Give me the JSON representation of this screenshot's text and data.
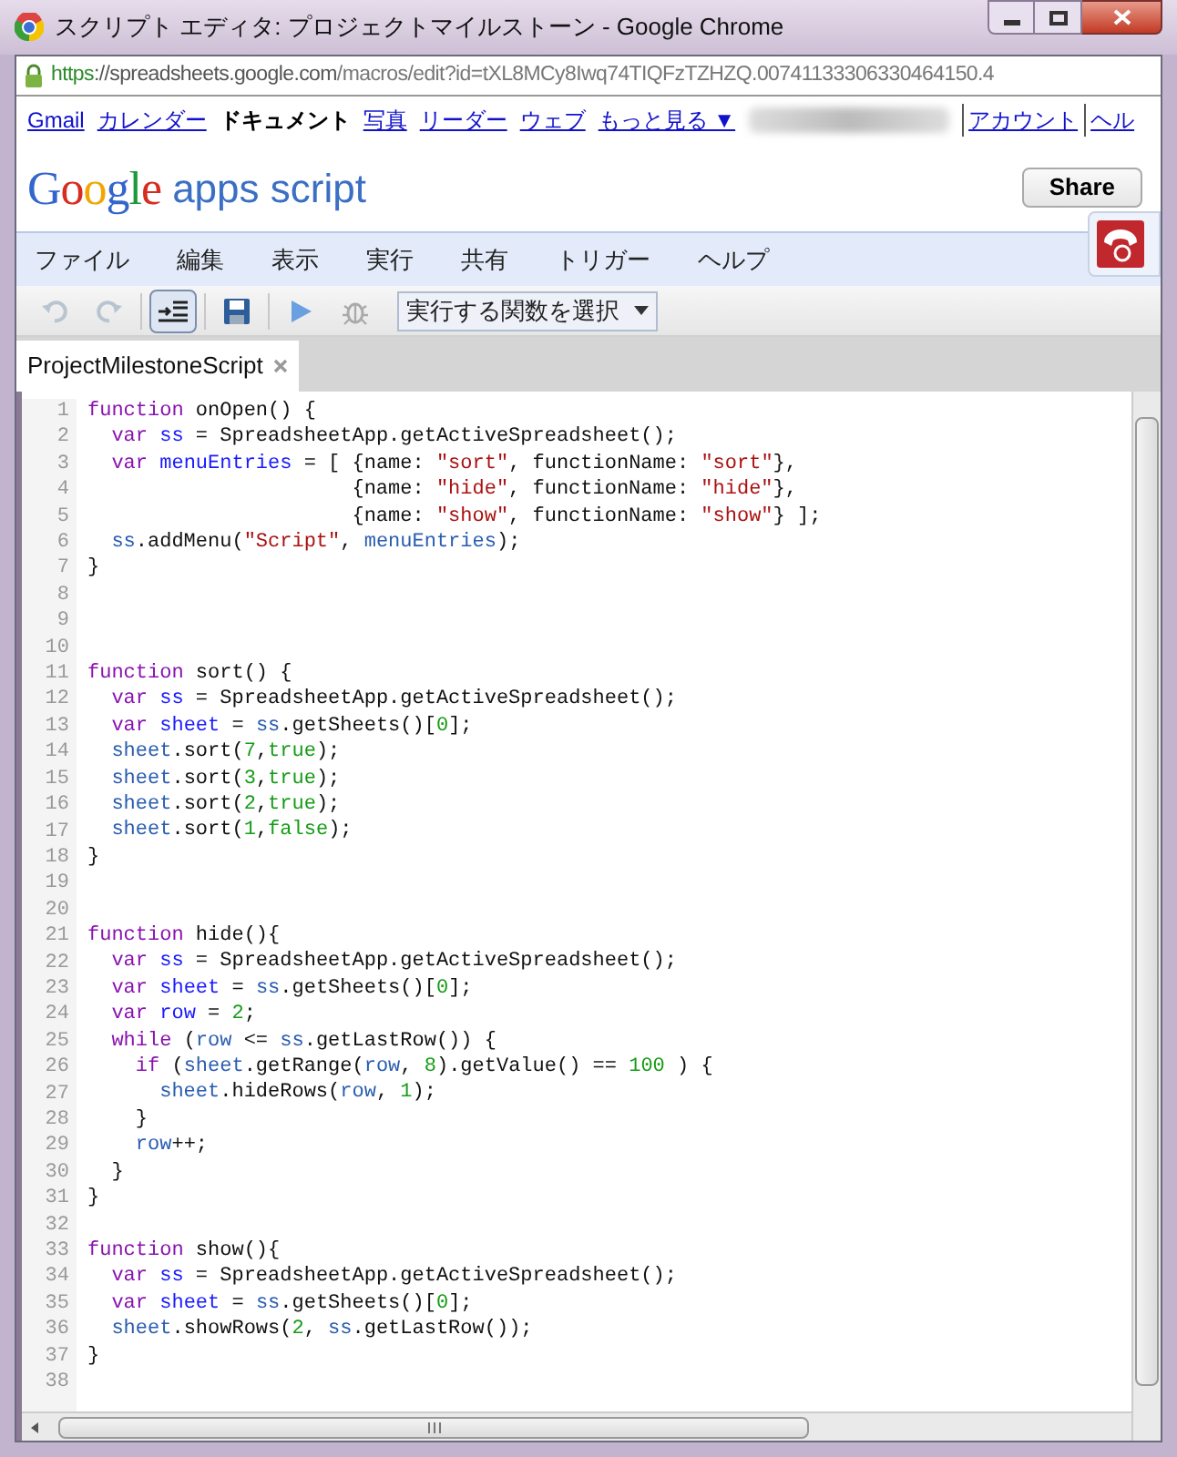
{
  "window": {
    "title": "スクリプト エディタ: プロジェクトマイルストーン - Google Chrome"
  },
  "address_bar": {
    "scheme": "https",
    "rest": "://spreadsheets.google.com",
    "path": "/macros/edit?id=tXL8MCy8Iwq74TIQFzTZHZQ.00741133306330464150.4"
  },
  "google_bar": {
    "items": [
      {
        "label": "Gmail",
        "selected": false
      },
      {
        "label": "カレンダー",
        "selected": false
      },
      {
        "label": "ドキュメント",
        "selected": true
      },
      {
        "label": "写真",
        "selected": false
      },
      {
        "label": "リーダー",
        "selected": false
      },
      {
        "label": "ウェブ",
        "selected": false
      },
      {
        "label": "もっと見る ▼",
        "selected": false
      }
    ],
    "account_links": [
      "アカウント",
      "ヘル"
    ]
  },
  "header": {
    "logo_word": "Google",
    "product": "apps script",
    "share_button": "Share"
  },
  "menu": [
    "ファイル",
    "編集",
    "表示",
    "実行",
    "共有",
    "トリガー",
    "ヘルプ"
  ],
  "toolbar": {
    "buttons": [
      {
        "kind": "undo",
        "disabled": true
      },
      {
        "kind": "redo",
        "disabled": true
      },
      {
        "kind": "indent",
        "pressed": true
      },
      {
        "kind": "save",
        "disabled": false
      },
      {
        "kind": "run",
        "disabled": false
      },
      {
        "kind": "debug",
        "disabled": true
      }
    ],
    "function_select": "実行する関数を選択"
  },
  "tabs": [
    {
      "label": "ProjectMilestoneScript",
      "selected": true
    }
  ],
  "code_lines": [
    {
      "number": "1",
      "tokens": [
        {
          "kind": "keyword",
          "text": "function"
        },
        {
          "kind": "plain",
          "text": " onOpen() {"
        }
      ]
    },
    {
      "number": "2",
      "tokens": [
        {
          "kind": "keyword",
          "text": "  var"
        },
        {
          "kind": "def",
          "text": " ss"
        },
        {
          "kind": "plain",
          "text": " = SpreadsheetApp.getActiveSpreadsheet();"
        }
      ]
    },
    {
      "number": "3",
      "tokens": [
        {
          "kind": "keyword",
          "text": "  var"
        },
        {
          "kind": "def",
          "text": " menuEntries"
        },
        {
          "kind": "plain",
          "text": " = [ {name: "
        },
        {
          "kind": "string",
          "text": "\"sort\""
        },
        {
          "kind": "plain",
          "text": ", functionName: "
        },
        {
          "kind": "string",
          "text": "\"sort\""
        },
        {
          "kind": "plain",
          "text": "},"
        }
      ]
    },
    {
      "number": "4",
      "tokens": [
        {
          "kind": "plain",
          "text": "                      {name: "
        },
        {
          "kind": "string",
          "text": "\"hide\""
        },
        {
          "kind": "plain",
          "text": ", functionName: "
        },
        {
          "kind": "string",
          "text": "\"hide\""
        },
        {
          "kind": "plain",
          "text": "},"
        }
      ]
    },
    {
      "number": "5",
      "tokens": [
        {
          "kind": "plain",
          "text": "                      {name: "
        },
        {
          "kind": "string",
          "text": "\"show\""
        },
        {
          "kind": "plain",
          "text": ", functionName: "
        },
        {
          "kind": "string",
          "text": "\"show\""
        },
        {
          "kind": "plain",
          "text": "} ];"
        }
      ]
    },
    {
      "number": "6",
      "tokens": [
        {
          "kind": "variable",
          "text": "  ss"
        },
        {
          "kind": "plain",
          "text": ".addMenu("
        },
        {
          "kind": "string",
          "text": "\"Script\""
        },
        {
          "kind": "plain",
          "text": ", "
        },
        {
          "kind": "variable",
          "text": "menuEntries"
        },
        {
          "kind": "plain",
          "text": ");"
        }
      ]
    },
    {
      "number": "7",
      "tokens": [
        {
          "kind": "plain",
          "text": "}"
        }
      ]
    },
    {
      "number": "8"
    },
    {
      "number": "9"
    },
    {
      "number": "10"
    },
    {
      "number": "11",
      "tokens": [
        {
          "kind": "keyword",
          "text": "function"
        },
        {
          "kind": "plain",
          "text": " sort() {"
        }
      ]
    },
    {
      "number": "12",
      "tokens": [
        {
          "kind": "keyword",
          "text": "  var"
        },
        {
          "kind": "def",
          "text": " ss"
        },
        {
          "kind": "plain",
          "text": " = SpreadsheetApp.getActiveSpreadsheet();"
        }
      ]
    },
    {
      "number": "13",
      "tokens": [
        {
          "kind": "keyword",
          "text": "  var"
        },
        {
          "kind": "def",
          "text": " sheet"
        },
        {
          "kind": "plain",
          "text": " = "
        },
        {
          "kind": "variable",
          "text": "ss"
        },
        {
          "kind": "plain",
          "text": ".getSheets()["
        },
        {
          "kind": "number",
          "text": "0"
        },
        {
          "kind": "plain",
          "text": "];"
        }
      ]
    },
    {
      "number": "14",
      "tokens": [
        {
          "kind": "variable",
          "text": "  sheet"
        },
        {
          "kind": "plain",
          "text": ".sort("
        },
        {
          "kind": "number",
          "text": "7"
        },
        {
          "kind": "plain",
          "text": ","
        },
        {
          "kind": "number",
          "text": "true"
        },
        {
          "kind": "plain",
          "text": ");"
        }
      ]
    },
    {
      "number": "15",
      "tokens": [
        {
          "kind": "variable",
          "text": "  sheet"
        },
        {
          "kind": "plain",
          "text": ".sort("
        },
        {
          "kind": "number",
          "text": "3"
        },
        {
          "kind": "plain",
          "text": ","
        },
        {
          "kind": "number",
          "text": "true"
        },
        {
          "kind": "plain",
          "text": ");"
        }
      ]
    },
    {
      "number": "16",
      "tokens": [
        {
          "kind": "variable",
          "text": "  sheet"
        },
        {
          "kind": "plain",
          "text": ".sort("
        },
        {
          "kind": "number",
          "text": "2"
        },
        {
          "kind": "plain",
          "text": ","
        },
        {
          "kind": "number",
          "text": "true"
        },
        {
          "kind": "plain",
          "text": ");"
        }
      ]
    },
    {
      "number": "17",
      "tokens": [
        {
          "kind": "variable",
          "text": "  sheet"
        },
        {
          "kind": "plain",
          "text": ".sort("
        },
        {
          "kind": "number",
          "text": "1"
        },
        {
          "kind": "plain",
          "text": ","
        },
        {
          "kind": "number",
          "text": "false"
        },
        {
          "kind": "plain",
          "text": ");"
        }
      ]
    },
    {
      "number": "18",
      "tokens": [
        {
          "kind": "plain",
          "text": "}"
        }
      ]
    },
    {
      "number": "19"
    },
    {
      "number": "20"
    },
    {
      "number": "21",
      "tokens": [
        {
          "kind": "keyword",
          "text": "function"
        },
        {
          "kind": "plain",
          "text": " hide(){"
        }
      ]
    },
    {
      "number": "22",
      "tokens": [
        {
          "kind": "keyword",
          "text": "  var"
        },
        {
          "kind": "def",
          "text": " ss"
        },
        {
          "kind": "plain",
          "text": " = SpreadsheetApp.getActiveSpreadsheet();"
        }
      ]
    },
    {
      "number": "23",
      "tokens": [
        {
          "kind": "keyword",
          "text": "  var"
        },
        {
          "kind": "def",
          "text": " sheet"
        },
        {
          "kind": "plain",
          "text": " = "
        },
        {
          "kind": "variable",
          "text": "ss"
        },
        {
          "kind": "plain",
          "text": ".getSheets()["
        },
        {
          "kind": "number",
          "text": "0"
        },
        {
          "kind": "plain",
          "text": "];"
        }
      ]
    },
    {
      "number": "24",
      "tokens": [
        {
          "kind": "keyword",
          "text": "  var"
        },
        {
          "kind": "def",
          "text": " row"
        },
        {
          "kind": "plain",
          "text": " = "
        },
        {
          "kind": "number",
          "text": "2"
        },
        {
          "kind": "plain",
          "text": ";"
        }
      ]
    },
    {
      "number": "25",
      "tokens": [
        {
          "kind": "keyword",
          "text": "  while"
        },
        {
          "kind": "plain",
          "text": " ("
        },
        {
          "kind": "variable",
          "text": "row"
        },
        {
          "kind": "plain",
          "text": " <= "
        },
        {
          "kind": "variable",
          "text": "ss"
        },
        {
          "kind": "plain",
          "text": ".getLastRow()) {"
        }
      ]
    },
    {
      "number": "26",
      "tokens": [
        {
          "kind": "keyword",
          "text": "    if"
        },
        {
          "kind": "plain",
          "text": " ("
        },
        {
          "kind": "variable",
          "text": "sheet"
        },
        {
          "kind": "plain",
          "text": ".getRange("
        },
        {
          "kind": "variable",
          "text": "row"
        },
        {
          "kind": "plain",
          "text": ", "
        },
        {
          "kind": "number",
          "text": "8"
        },
        {
          "kind": "plain",
          "text": ").getValue() == "
        },
        {
          "kind": "number",
          "text": "100"
        },
        {
          "kind": "plain",
          "text": " ) {"
        }
      ]
    },
    {
      "number": "27",
      "tokens": [
        {
          "kind": "variable",
          "text": "      sheet"
        },
        {
          "kind": "plain",
          "text": ".hideRows("
        },
        {
          "kind": "variable",
          "text": "row"
        },
        {
          "kind": "plain",
          "text": ", "
        },
        {
          "kind": "number",
          "text": "1"
        },
        {
          "kind": "plain",
          "text": ");"
        }
      ]
    },
    {
      "number": "28",
      "tokens": [
        {
          "kind": "plain",
          "text": "    }"
        }
      ]
    },
    {
      "number": "29",
      "tokens": [
        {
          "kind": "variable",
          "text": "    row"
        },
        {
          "kind": "plain",
          "text": "++;"
        }
      ]
    },
    {
      "number": "30",
      "tokens": [
        {
          "kind": "plain",
          "text": "  }"
        }
      ]
    },
    {
      "number": "31",
      "tokens": [
        {
          "kind": "plain",
          "text": "}"
        }
      ]
    },
    {
      "number": "32"
    },
    {
      "number": "33",
      "tokens": [
        {
          "kind": "keyword",
          "text": "function"
        },
        {
          "kind": "plain",
          "text": " show(){"
        }
      ]
    },
    {
      "number": "34",
      "tokens": [
        {
          "kind": "keyword",
          "text": "  var"
        },
        {
          "kind": "def",
          "text": " ss"
        },
        {
          "kind": "plain",
          "text": " = SpreadsheetApp.getActiveSpreadsheet();"
        }
      ]
    },
    {
      "number": "35",
      "tokens": [
        {
          "kind": "keyword",
          "text": "  var"
        },
        {
          "kind": "def",
          "text": " sheet"
        },
        {
          "kind": "plain",
          "text": " = "
        },
        {
          "kind": "variable",
          "text": "ss"
        },
        {
          "kind": "plain",
          "text": ".getSheets()["
        },
        {
          "kind": "number",
          "text": "0"
        },
        {
          "kind": "plain",
          "text": "];"
        }
      ]
    },
    {
      "number": "36",
      "tokens": [
        {
          "kind": "variable",
          "text": "  sheet"
        },
        {
          "kind": "plain",
          "text": ".showRows("
        },
        {
          "kind": "number",
          "text": "2"
        },
        {
          "kind": "plain",
          "text": ", "
        },
        {
          "kind": "variable",
          "text": "ss"
        },
        {
          "kind": "plain",
          "text": ".getLastRow());"
        }
      ]
    },
    {
      "number": "37",
      "tokens": [
        {
          "kind": "plain",
          "text": "}"
        }
      ]
    },
    {
      "number": "38"
    }
  ]
}
